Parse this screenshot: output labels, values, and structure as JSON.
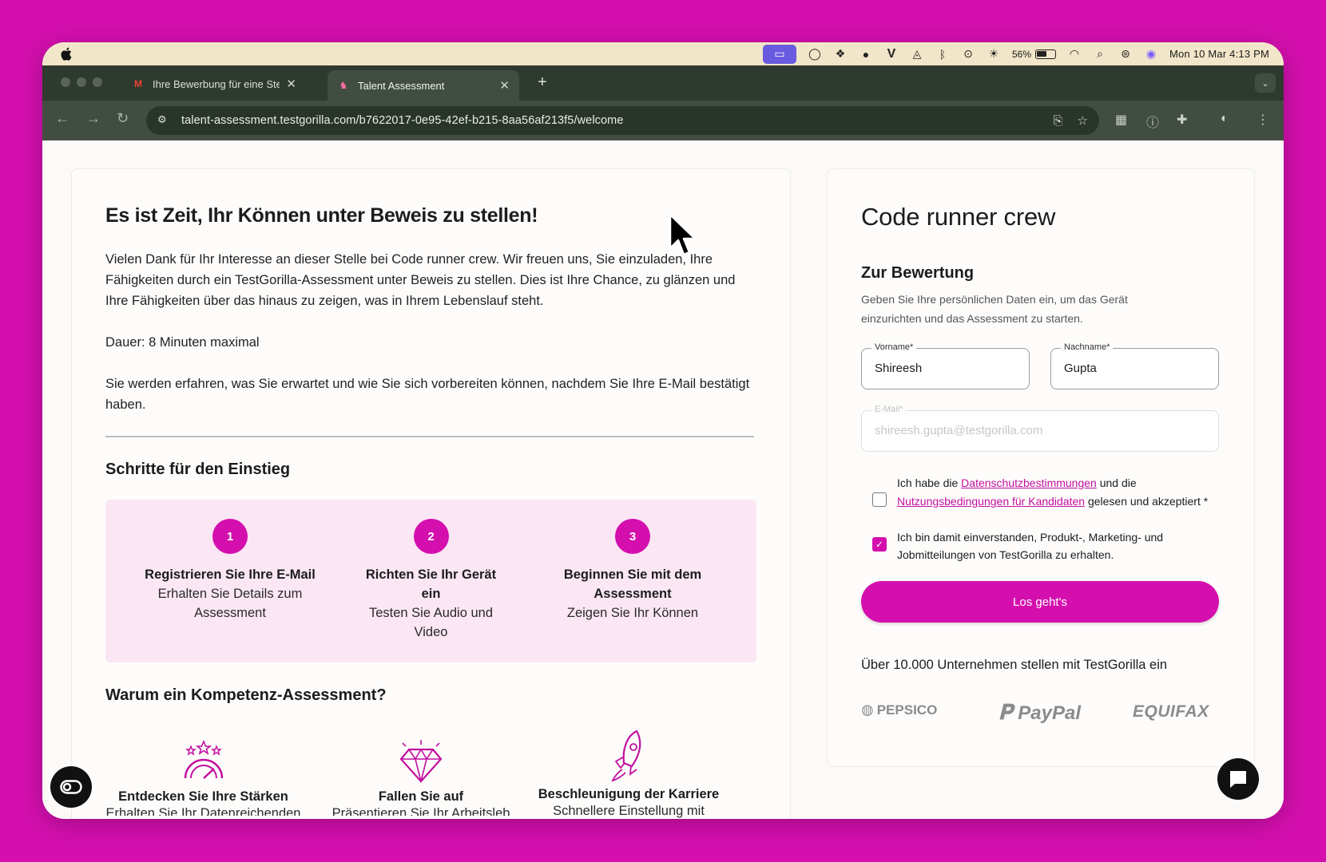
{
  "menubar": {
    "battery_percent": "56%",
    "battery_level": 0.56,
    "clock": "Mon 10 Mar  4:13 PM",
    "status_icons": [
      "screen-mirroring-icon",
      "circle-icon",
      "figma-icon",
      "grammarly-icon",
      "v-icon",
      "drive-icon",
      "bluetooth-icon",
      "play-icon",
      "brightness-icon",
      "battery-icon",
      "wifi-icon",
      "search-icon",
      "control-center-icon",
      "siri-icon"
    ]
  },
  "browser": {
    "tabs": [
      {
        "title": "Ihre Bewerbung für eine Stelle",
        "favicon": "gmail-icon"
      },
      {
        "title": "Talent Assessment",
        "favicon": "testgorilla-icon"
      }
    ],
    "url": "talent-assessment.testgorilla.com/b7622017-0e95-42ef-b215-8aa56af213f5/welcome"
  },
  "left": {
    "title": "Es ist Zeit, Ihr Können unter Beweis zu stellen!",
    "intro": "Vielen Dank für Ihr Interesse an dieser Stelle bei Code runner crew. Wir freuen uns, Sie einzuladen, Ihre Fähigkeiten durch ein TestGorilla-Assessment unter Beweis zu stellen. Dies ist Ihre Chance, zu glänzen und Ihre Fähigkeiten über das hinaus zu zeigen, was in Ihrem Lebenslauf steht.",
    "duration": "Dauer: 8 Minuten maximal",
    "info": "Sie werden erfahren, was Sie erwartet und wie Sie sich vorbereiten können, nachdem Sie Ihre E-Mail bestätigt haben.",
    "steps_title": "Schritte für den Einstieg",
    "steps": [
      {
        "num": "1",
        "title": "Registrieren Sie Ihre E-Mail",
        "desc": "Erhalten Sie Details zum Assessment"
      },
      {
        "num": "2",
        "title": "Richten Sie Ihr Gerät ein",
        "desc": "Testen Sie Audio und Video"
      },
      {
        "num": "3",
        "title": "Beginnen Sie mit dem Assessment",
        "desc": "Zeigen Sie Ihr Können"
      }
    ],
    "why_title": "Warum ein Kompetenz-Assessment?",
    "why": [
      {
        "title": "Entdecken Sie Ihre Stärken",
        "desc": "Erhalten Sie Ihr Datenreichenden",
        "icon": "gauge-stars-icon"
      },
      {
        "title": "Fallen Sie auf",
        "desc": "Präsentieren Sie Ihr Arbeitsleb",
        "icon": "diamond-icon"
      },
      {
        "title": "Beschleunigung der Karriere",
        "desc": "Schnellere Einstellung mit",
        "icon": "rocket-icon"
      }
    ]
  },
  "right": {
    "company": "Code runner crew",
    "heading": "Zur Bewertung",
    "subtitle": "Geben Sie Ihre persönlichen Daten ein, um das Gerät einzurichten und das Assessment zu starten.",
    "firstname": {
      "label": "Vorname*",
      "value": "Shireesh"
    },
    "lastname": {
      "label": "Nachname*",
      "value": "Gupta"
    },
    "email": {
      "label": "E-Mail*",
      "value": "shireesh.gupta@testgorilla.com"
    },
    "consent1": {
      "pre": "Ich habe die ",
      "link1": "Datenschutzbestimmungen",
      "mid": " und die ",
      "link2": "Nutzungsbedingungen für Kandidaten",
      "post": " gelesen und akzeptiert *"
    },
    "consent2": "Ich bin damit einverstanden, Produkt-, Marketing- und Jobmitteilungen von TestGorilla zu erhalten.",
    "cta": "Los geht's",
    "trust": "Über 10.000 Unternehmen stellen mit TestGorilla ein",
    "logos": [
      "PEPSICO",
      "PayPal",
      "EQUIFAX"
    ]
  },
  "colors": {
    "accent": "#d40fae",
    "background": "#d40fae",
    "chrome": "#2f3a2e"
  }
}
